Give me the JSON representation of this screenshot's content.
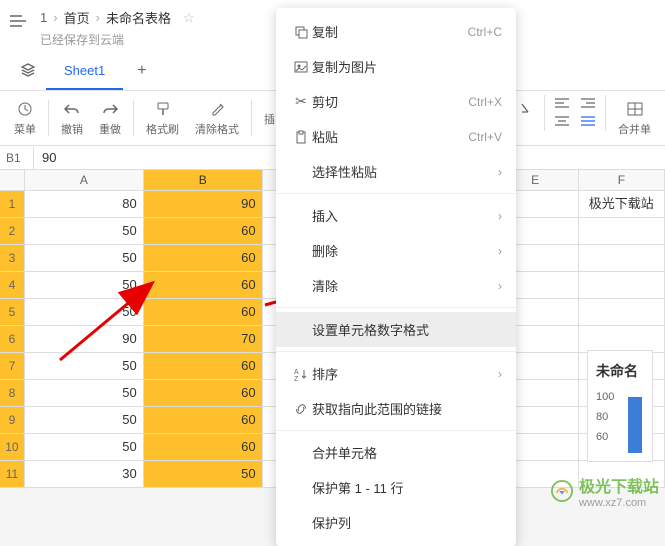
{
  "breadcrumb": {
    "page_num": "1",
    "home": "首页",
    "doc_name": "未命名表格"
  },
  "save_status": "已经保存到云端",
  "tabs": {
    "sheet1": "Sheet1"
  },
  "toolbar": {
    "menu": "菜单",
    "undo": "撤销",
    "redo": "重做",
    "format_painter": "格式刷",
    "clear_format": "清除格式",
    "insert_placeholder": "插",
    "merge_label": "合并单"
  },
  "formula_bar": {
    "ref": "B1",
    "value": "90"
  },
  "columns": {
    "a": "A",
    "b": "B",
    "e": "E",
    "f": "F"
  },
  "rows": [
    {
      "n": "1",
      "a": "80",
      "b": "90",
      "f": "极光下载站"
    },
    {
      "n": "2",
      "a": "50",
      "b": "60"
    },
    {
      "n": "3",
      "a": "50",
      "b": "60"
    },
    {
      "n": "4",
      "a": "50",
      "b": "60"
    },
    {
      "n": "5",
      "a": "50",
      "b": "60"
    },
    {
      "n": "6",
      "a": "90",
      "b": "70"
    },
    {
      "n": "7",
      "a": "50",
      "b": "60"
    },
    {
      "n": "8",
      "a": "50",
      "b": "60"
    },
    {
      "n": "9",
      "a": "50",
      "b": "60"
    },
    {
      "n": "10",
      "a": "50",
      "b": "60"
    },
    {
      "n": "11",
      "a": "30",
      "b": "50"
    }
  ],
  "context_menu": {
    "copy": "复制",
    "copy_sc": "Ctrl+C",
    "copy_img": "复制为图片",
    "cut": "剪切",
    "cut_sc": "Ctrl+X",
    "paste": "粘贴",
    "paste_sc": "Ctrl+V",
    "paste_special": "选择性粘贴",
    "insert": "插入",
    "delete": "删除",
    "clear": "清除",
    "number_format": "设置单元格数字格式",
    "sort": "排序",
    "get_link": "获取指向此范围的链接",
    "merge": "合并单元格",
    "protect_rows": "保护第 1 - 11 行",
    "protect_col": "保护列"
  },
  "chart_panel": {
    "title": "未命名",
    "tick100": "100",
    "tick80": "80",
    "tick60": "60"
  },
  "watermark": {
    "name": "极光下载站",
    "url": "www.xz7.com"
  },
  "chart_data": {
    "type": "table",
    "columns": [
      "A",
      "B"
    ],
    "rows": [
      [
        80,
        90
      ],
      [
        50,
        60
      ],
      [
        50,
        60
      ],
      [
        50,
        60
      ],
      [
        50,
        60
      ],
      [
        90,
        70
      ],
      [
        50,
        60
      ],
      [
        50,
        60
      ],
      [
        50,
        60
      ],
      [
        50,
        60
      ],
      [
        30,
        50
      ]
    ]
  }
}
